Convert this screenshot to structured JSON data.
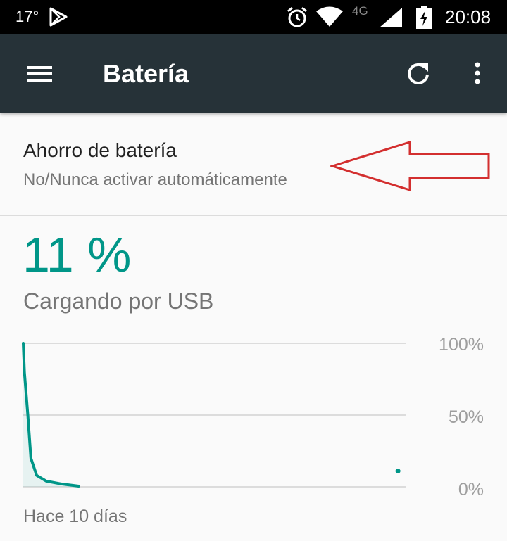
{
  "status_bar": {
    "temperature": "17°",
    "network_type": "4G",
    "time": "20:08",
    "icons": [
      "play-store-icon",
      "alarm-icon",
      "wifi-icon",
      "cell-signal-icon",
      "battery-charging-icon"
    ]
  },
  "app_bar": {
    "title": "Batería",
    "icons": [
      "menu-icon",
      "refresh-icon",
      "more-vert-icon"
    ],
    "color": "#263238"
  },
  "battery_saver": {
    "title": "Ahorro de batería",
    "summary": "No/Nunca activar automáticamente"
  },
  "battery": {
    "level": "11 %",
    "status": "Cargando por USB"
  },
  "chart_data": {
    "type": "line",
    "x_start_label": "Hace 10 días",
    "y_tick_labels": [
      "100%",
      "50%",
      "0%"
    ],
    "ylim": [
      0,
      100
    ],
    "series": [
      {
        "x": [
          0,
          0.003,
          0.012,
          0.02,
          0.035,
          0.06,
          0.1,
          0.145
        ],
        "y": [
          100,
          80,
          50,
          20,
          8,
          4,
          2,
          0.5
        ]
      }
    ],
    "current_point": {
      "x": 0.98,
      "y": 11
    },
    "line_color": "#009688",
    "grid": true
  },
  "colors": {
    "accent": "#009688",
    "annotation_arrow": "#d32f2f"
  }
}
